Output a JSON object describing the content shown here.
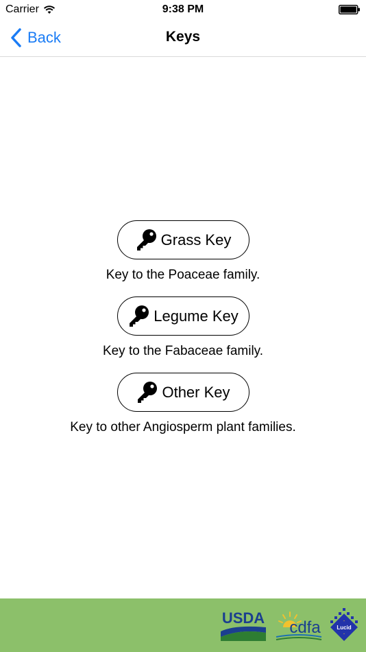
{
  "status_bar": {
    "carrier": "Carrier",
    "time": "9:38 PM"
  },
  "nav": {
    "back_label": "Back",
    "title": "Keys"
  },
  "keys": [
    {
      "label": "Grass Key",
      "description": "Key to the Poaceae family."
    },
    {
      "label": "Legume Key",
      "description": "Key to the Fabaceae family."
    },
    {
      "label": "Other Key",
      "description": "Key to other Angiosperm plant families."
    }
  ],
  "footer": {
    "logos": {
      "usda": "USDA",
      "cdfa": "cdfa",
      "lucid": "Lucid"
    }
  },
  "colors": {
    "accent": "#1a7cf5",
    "footer_bg": "#8cc06a",
    "usda_blue": "#1b3f8f",
    "usda_green": "#2e7d32"
  },
  "icons": {
    "wifi": "wifi-icon",
    "battery": "battery-icon",
    "back": "chevron-left-icon",
    "key": "key-icon"
  }
}
